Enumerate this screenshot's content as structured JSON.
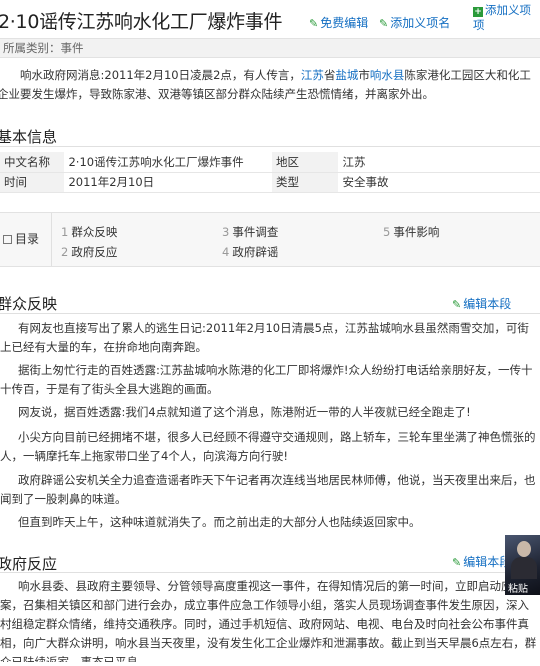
{
  "title": "2·10谣传江苏响水化工厂爆炸事件",
  "actions": {
    "free_edit": "免费编辑",
    "add_meaning": "添加义项名",
    "add_meaning_stack": "添加义项"
  },
  "category": "所属类别：事件",
  "intro": {
    "before": "响水政府网消息:2011年2月10日凌晨2点，有人传言，",
    "link_jiangsu": "江苏",
    "mid1": "省",
    "link_yancheng": "盐城",
    "mid2": "市",
    "link_xiangshui": "响水县",
    "after": "陈家港化工园区大和化工企业要发生爆炸，导致陈家港、双港等镇区部分群众陆续产生恐慌情绪，并离家外出。"
  },
  "basic_info": {
    "heading": "基本信息",
    "rows": [
      {
        "k1": "中文名称",
        "v1": "2·10谣传江苏响水化工厂爆炸事件",
        "k2": "地区",
        "v2": "江苏"
      },
      {
        "k1": "时间",
        "v1": "2011年2月10日",
        "k2": "类型",
        "v2": "安全事故"
      }
    ]
  },
  "toc": {
    "label": "目录",
    "items": [
      {
        "num": "1",
        "label": "群众反映"
      },
      {
        "num": "2",
        "label": "政府反应"
      },
      {
        "num": "3",
        "label": "事件调查"
      },
      {
        "num": "4",
        "label": "政府辟谣"
      },
      {
        "num": "5",
        "label": "事件影响"
      }
    ]
  },
  "section1": {
    "heading": "群众反映",
    "edit": "编辑本段",
    "paras": [
      "有网友也直接写出了累人的逃生日记:2011年2月10日清晨5点，江苏盐城响水县虽然雨雪交加，可街上已经有大量的车，在拚命地向南奔跑。",
      "据街上匆忙行走的百姓透露:江苏盐城响水陈港的化工厂即将爆炸!众人纷纷打电话给亲朋好友，一传十十传百，于是有了街头全县大逃跑的画面。",
      "网友说，据百姓透露:我们4点就知道了这个消息，陈港附近一带的人半夜就已经全跑走了!",
      "小尖方向目前已经拥堵不堪，很多人已经顾不得遵守交通规则，路上轿车，三轮车里坐满了神色慌张的人，一辆摩托车上拖家带口坐了4个人，向滨海方向行驶!",
      "政府辟谣公安机关全力追查造谣者昨天下午记者再次连线当地居民林师傅，他说，当天夜里出来后，也闻到了一股刺鼻的味道。",
      "但直到昨天上午，这种味道就消失了。而之前出走的大部分人也陆续返回家中。"
    ]
  },
  "section2": {
    "heading": "政府反应",
    "edit": "编辑本段",
    "para": "响水县委、县政府主要领导、分管领导高度重视这一事件，在得知情况后的第一时间，立即启动应急预案，召集相关镇区和部门进行会办，成立事件应急工作领导小组，落实人员现场调查事件发生原因，深入村组稳定群众情绪，维持交通秩序。同时，通过手机短信、政府网站、电视、电台及时向社会公布事件真相，向广大群众讲明，响水县当天夜里，没有发生化工企业爆炸和泄漏事故。截止到当天早晨6点左右，群众已陆续返家，事态已平息。"
  },
  "thumb_label": "粘贴"
}
